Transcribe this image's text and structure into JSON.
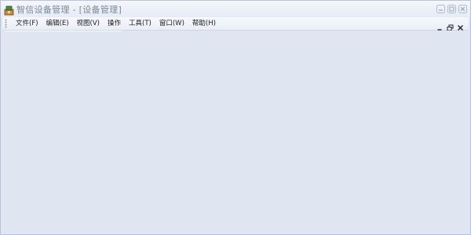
{
  "window": {
    "title": "智信设备管理 - [设备管理]",
    "title_color": "#7d8799",
    "background": "#dfe5f1"
  },
  "icons": {
    "app": "app-logo-icon",
    "minimize": "minimize-icon",
    "maximize": "maximize-icon",
    "close": "close-icon",
    "mdi_minimize": "mdi-minimize-icon",
    "mdi_restore": "mdi-restore-icon",
    "mdi_close": "mdi-close-icon"
  },
  "menu": {
    "file": "文件(F)",
    "edit": "编辑(E)",
    "view": "视图(V)",
    "operate": "操作",
    "tools": "工具(T)",
    "window": "窗口(W)",
    "help": "帮助(H)"
  }
}
